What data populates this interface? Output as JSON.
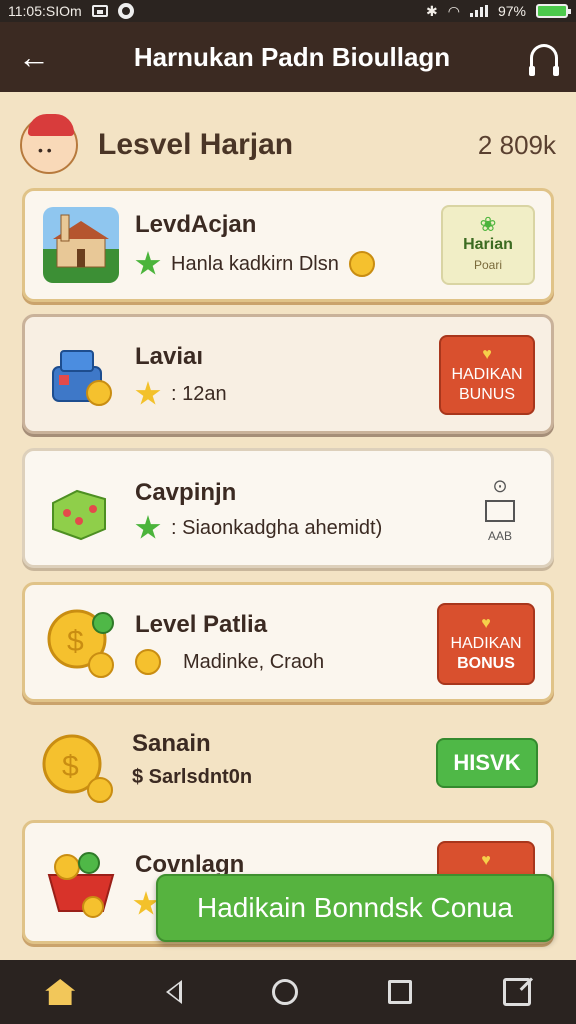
{
  "status_bar": {
    "time": "11:05:SIOm",
    "battery": "97%",
    "icons": [
      "photo-icon",
      "circle-icon",
      "bluetooth-icon",
      "wifi-icon",
      "signal-icon",
      "battery-icon"
    ]
  },
  "app_bar": {
    "title": "Harnukan Padn Bioullagn",
    "back_icon": "arrow-left-icon",
    "support_icon": "headset-icon"
  },
  "header": {
    "title": "Lesvel Harjan",
    "score": "2 809k"
  },
  "cards": [
    {
      "title": "LevdAcjan",
      "subtitle": "Hanla kadkirn Dlsn",
      "action_label_1": "Harian",
      "action_label_2": "Poari",
      "action_style": "pale",
      "thumb_icon": "building-icon"
    },
    {
      "title": "Laviaı",
      "subtitle": ": 12an",
      "action_label_1": "HADIKAN",
      "action_label_2": "BUNUS",
      "action_style": "red",
      "thumb_icon": "cash-register-icon"
    },
    {
      "title": "Cavpinjn",
      "subtitle": ": Siaonkadgha ahemidt)",
      "action_label_1": "",
      "action_label_2": "AAB",
      "action_style": "icon",
      "thumb_icon": "dice-box-icon"
    },
    {
      "title": "Level Patlia",
      "subtitle": "Madinke, Craoh",
      "action_label_1": "HADIKAN",
      "action_label_2": "BONUS",
      "action_style": "red",
      "thumb_icon": "gold-coins-icon"
    },
    {
      "title": "Sanain",
      "subtitle": "$ Sarlsdnt0n",
      "action_label_1": "HISVK",
      "action_label_2": "",
      "action_style": "green",
      "thumb_icon": "coin-stack-icon"
    },
    {
      "title": "Covnlagn",
      "subtitle": "",
      "action_label_1": "",
      "action_label_2": "",
      "action_style": "red",
      "thumb_icon": "coin-basket-icon"
    }
  ],
  "floating_button": {
    "label": "Hadikain Bonndsk Conua"
  },
  "nav_bar": {
    "icons": [
      "home-icon",
      "back-icon",
      "home-circle-icon",
      "recent-apps-icon",
      "edit-icon"
    ]
  },
  "colors": {
    "app_bar_bg": "#3b2a22",
    "page_bg": "#f3e3c4",
    "card_bg": "#fbf6ee",
    "button_red": "#d9502e",
    "button_green": "#4fb847",
    "floating_green": "#56b33f"
  }
}
